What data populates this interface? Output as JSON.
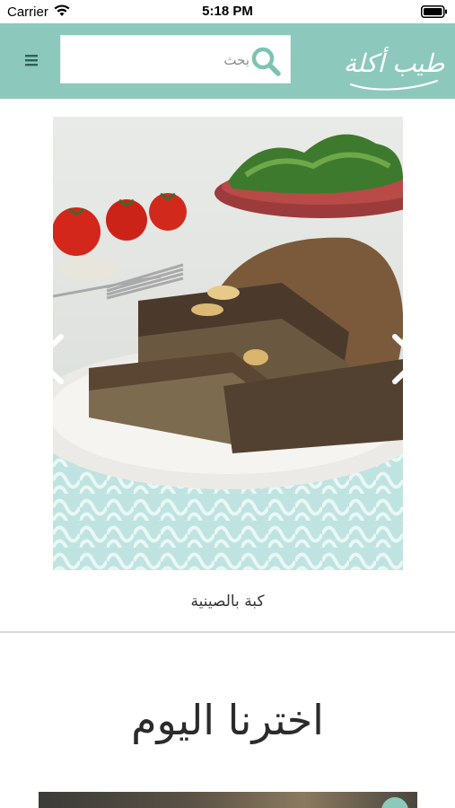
{
  "status_bar": {
    "carrier": "Carrier",
    "time": "5:18 PM"
  },
  "header": {
    "search_placeholder": "بحث",
    "logo_text": "أطيب أكلة",
    "icons": [
      "menu-icon",
      "search-icon"
    ]
  },
  "carousel": {
    "caption": "كبة بالصينية",
    "image": "kibbeh-tray-photo",
    "prev_icon": "chevron-left-icon",
    "next_icon": "chevron-right-icon"
  },
  "featured": {
    "heading": "اخترنا اليوم"
  },
  "colors": {
    "header_bg": "#8cc9bc",
    "accent": "#5fb3a2"
  }
}
